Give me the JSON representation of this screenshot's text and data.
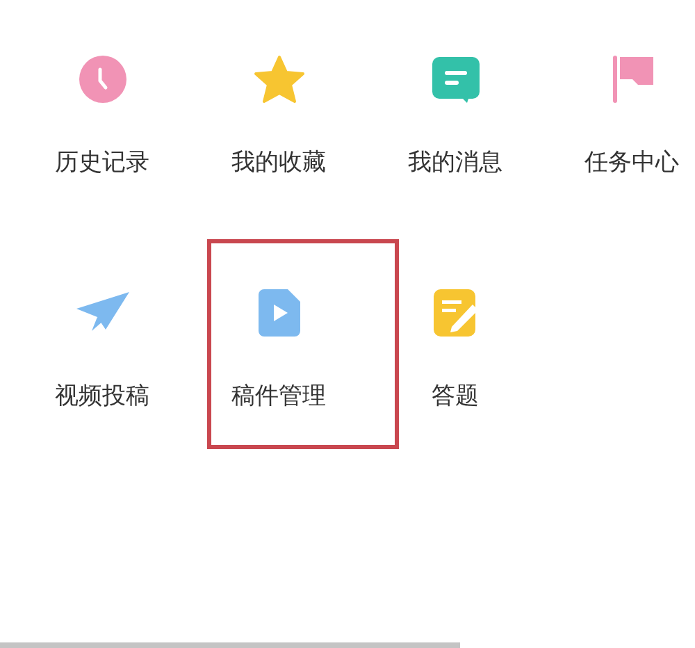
{
  "menu_items": [
    {
      "label": "历史记录",
      "kind": "clock",
      "selected": false
    },
    {
      "label": "我的收藏",
      "kind": "star",
      "selected": false
    },
    {
      "label": "我的消息",
      "kind": "message",
      "selected": false
    },
    {
      "label": "任务中心",
      "kind": "flag",
      "selected": false
    },
    {
      "label": "视频投稿",
      "kind": "plane",
      "selected": false
    },
    {
      "label": "稿件管理",
      "kind": "video-file",
      "selected": true
    },
    {
      "label": "答题",
      "kind": "note",
      "selected": false
    }
  ]
}
